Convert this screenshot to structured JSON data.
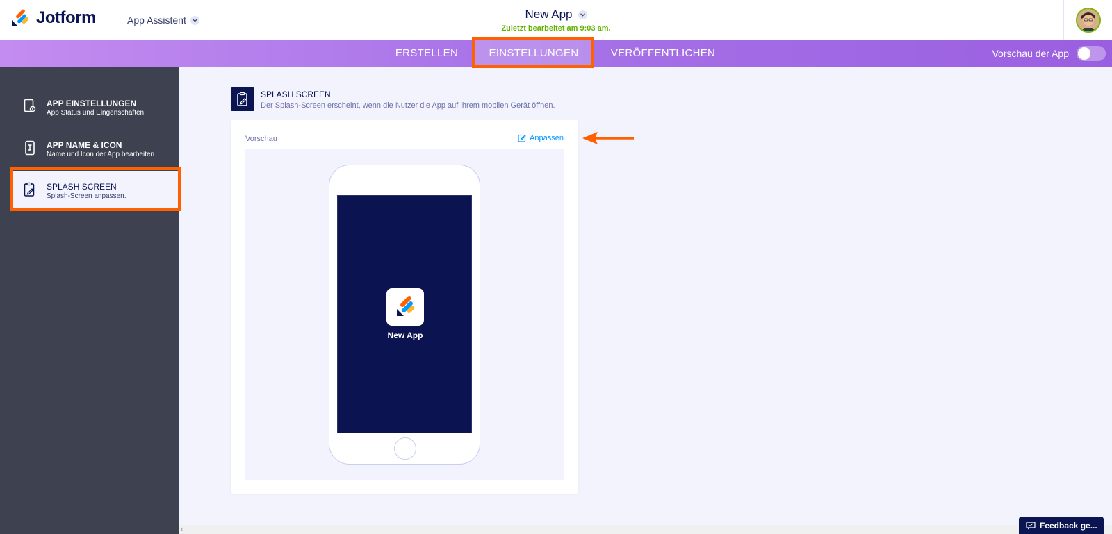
{
  "header": {
    "brand": "Jotform",
    "app_assistant": "App Assistent",
    "app_title": "New App",
    "last_edited": "Zuletzt bearbeitet am 9:03 am."
  },
  "nav": {
    "tabs": [
      {
        "label": "ERSTELLEN"
      },
      {
        "label": "EINSTELLUNGEN"
      },
      {
        "label": "VERÖFFENTLICHEN"
      }
    ],
    "preview_label": "Vorschau der App"
  },
  "sidebar": {
    "items": [
      {
        "title": "APP EINSTELLUNGEN",
        "subtitle": "App Status und Eingenschaften"
      },
      {
        "title": "APP NAME & ICON",
        "subtitle": "Name und Icon der App bearbeiten"
      },
      {
        "title": "SPLASH SCREEN",
        "subtitle": "Splash-Screen anpassen."
      }
    ]
  },
  "section": {
    "title": "SPLASH SCREEN",
    "description": "Der Splash-Screen erscheint, wenn die Nutzer die App auf ihrem mobilen Gerät öffnen."
  },
  "card": {
    "label": "Vorschau",
    "customize": "Anpassen"
  },
  "phone": {
    "app_name": "New App"
  },
  "feedback": {
    "label": "Feedback ge..."
  },
  "colors": {
    "accent_highlight": "#ff6100",
    "splash_background": "#0b1450",
    "link": "#0099ff"
  }
}
